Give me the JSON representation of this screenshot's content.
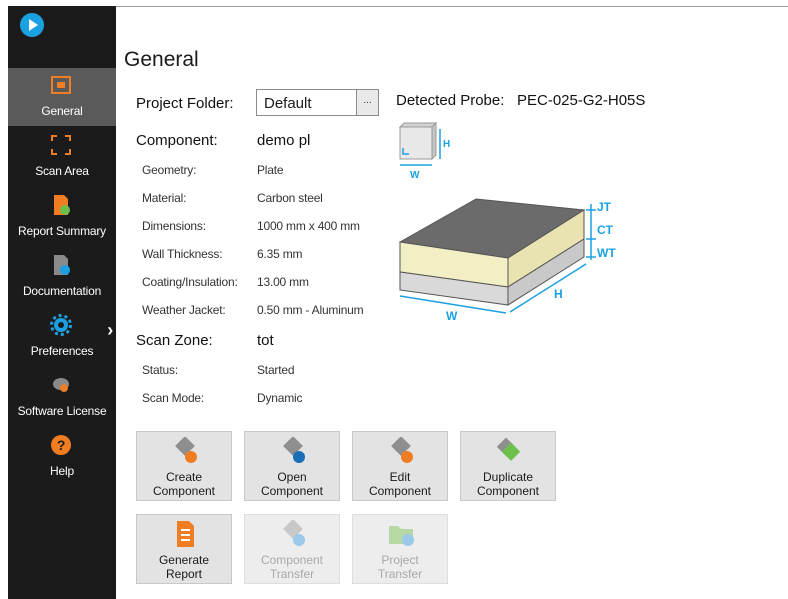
{
  "sidebar": {
    "items": [
      {
        "label": "General",
        "icon": "general-icon",
        "active": true
      },
      {
        "label": "Scan Area",
        "icon": "scan-area-icon"
      },
      {
        "label": "Report Summary",
        "icon": "report-summary-icon"
      },
      {
        "label": "Documentation",
        "icon": "documentation-icon"
      },
      {
        "label": "Preferences",
        "icon": "gear-icon"
      },
      {
        "label": "Software License",
        "icon": "software-license-icon"
      },
      {
        "label": "Help",
        "icon": "help-icon"
      }
    ],
    "chevron": "›"
  },
  "page": {
    "title": "General"
  },
  "project_folder": {
    "label": "Project Folder:",
    "value": "Default",
    "browse": "..."
  },
  "probe": {
    "label": "Detected Probe:",
    "value": "PEC-025-G2-H05S"
  },
  "component": {
    "label": "Component:",
    "value": "demo pl",
    "rows": [
      {
        "label": "Geometry:",
        "value": "Plate"
      },
      {
        "label": "Material:",
        "value": "Carbon steel"
      },
      {
        "label": "Dimensions:",
        "value": "1000 mm x 400 mm"
      },
      {
        "label": "Wall Thickness:",
        "value": "6.35 mm"
      },
      {
        "label": "Coating/Insulation:",
        "value": "13.00 mm"
      },
      {
        "label": "Weather Jacket:",
        "value": "0.50 mm - Aluminum"
      }
    ]
  },
  "scan_zone": {
    "label": "Scan Zone:",
    "value": "tot",
    "rows": [
      {
        "label": "Status:",
        "value": "Started"
      },
      {
        "label": "Scan Mode:",
        "value": "Dynamic"
      }
    ]
  },
  "diagram": {
    "small": {
      "h": "H",
      "w": "W"
    },
    "big": {
      "jt": "JT",
      "ct": "CT",
      "wt": "WT",
      "w": "W",
      "h": "H"
    },
    "colors": {
      "dim": "#1ba1e2",
      "top": "#6b6b6b",
      "insulation": "#f3efc4",
      "steel": "#d9d9d9"
    }
  },
  "actions": {
    "create": "Create\nComponent",
    "open": "Open\nComponent",
    "edit": "Edit\nComponent",
    "duplicate": "Duplicate\nComponent",
    "generate": "Generate\nReport",
    "transfer": "Component\nTransfer",
    "project_transfer": "Project\nTransfer"
  }
}
